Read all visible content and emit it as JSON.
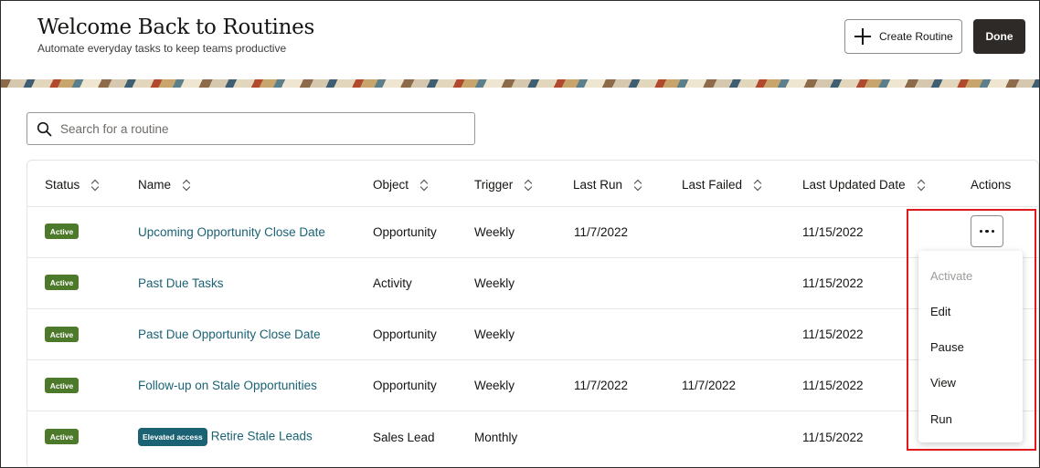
{
  "header": {
    "title": "Welcome Back to Routines",
    "subtitle": "Automate everyday tasks to keep teams productive",
    "create_label": "Create Routine",
    "done_label": "Done",
    "plus_icon": "plus-icon"
  },
  "search": {
    "placeholder": "Search for a routine",
    "value": "",
    "icon": "search-icon"
  },
  "table": {
    "columns": [
      "Status",
      "Name",
      "Object",
      "Trigger",
      "Last Run",
      "Last Failed",
      "Last Updated Date",
      "Actions"
    ],
    "rows": [
      {
        "status": "Active",
        "badge": "",
        "name": "Upcoming Opportunity Close Date",
        "object": "Opportunity",
        "trigger": "Weekly",
        "last_run": "11/7/2022",
        "last_failed": "",
        "last_updated": "11/15/2022"
      },
      {
        "status": "Active",
        "badge": "",
        "name": "Past Due Tasks",
        "object": "Activity",
        "trigger": "Weekly",
        "last_run": "",
        "last_failed": "",
        "last_updated": "11/15/2022"
      },
      {
        "status": "Active",
        "badge": "",
        "name": "Past Due Opportunity Close Date",
        "object": "Opportunity",
        "trigger": "Weekly",
        "last_run": "",
        "last_failed": "",
        "last_updated": "11/15/2022"
      },
      {
        "status": "Active",
        "badge": "",
        "name": "Follow-up on Stale Opportunities",
        "object": "Opportunity",
        "trigger": "Weekly",
        "last_run": "11/7/2022",
        "last_failed": "11/7/2022",
        "last_updated": "11/15/2022"
      },
      {
        "status": "Active",
        "badge": "Elevated access",
        "name": "Retire Stale Leads",
        "object": "Sales Lead",
        "trigger": "Monthly",
        "last_run": "",
        "last_failed": "",
        "last_updated": "11/15/2022"
      }
    ]
  },
  "actions_menu": {
    "trigger_icon": "more-horizontal-icon",
    "items": [
      {
        "label": "Activate",
        "disabled": true
      },
      {
        "label": "Edit",
        "disabled": false
      },
      {
        "label": "Pause",
        "disabled": false
      },
      {
        "label": "View",
        "disabled": false
      },
      {
        "label": "Run",
        "disabled": false
      }
    ]
  },
  "colors": {
    "active_badge": "#4d7a2a",
    "link": "#1b6275",
    "done_button": "#2d2a28",
    "highlight": "#e0191d"
  }
}
